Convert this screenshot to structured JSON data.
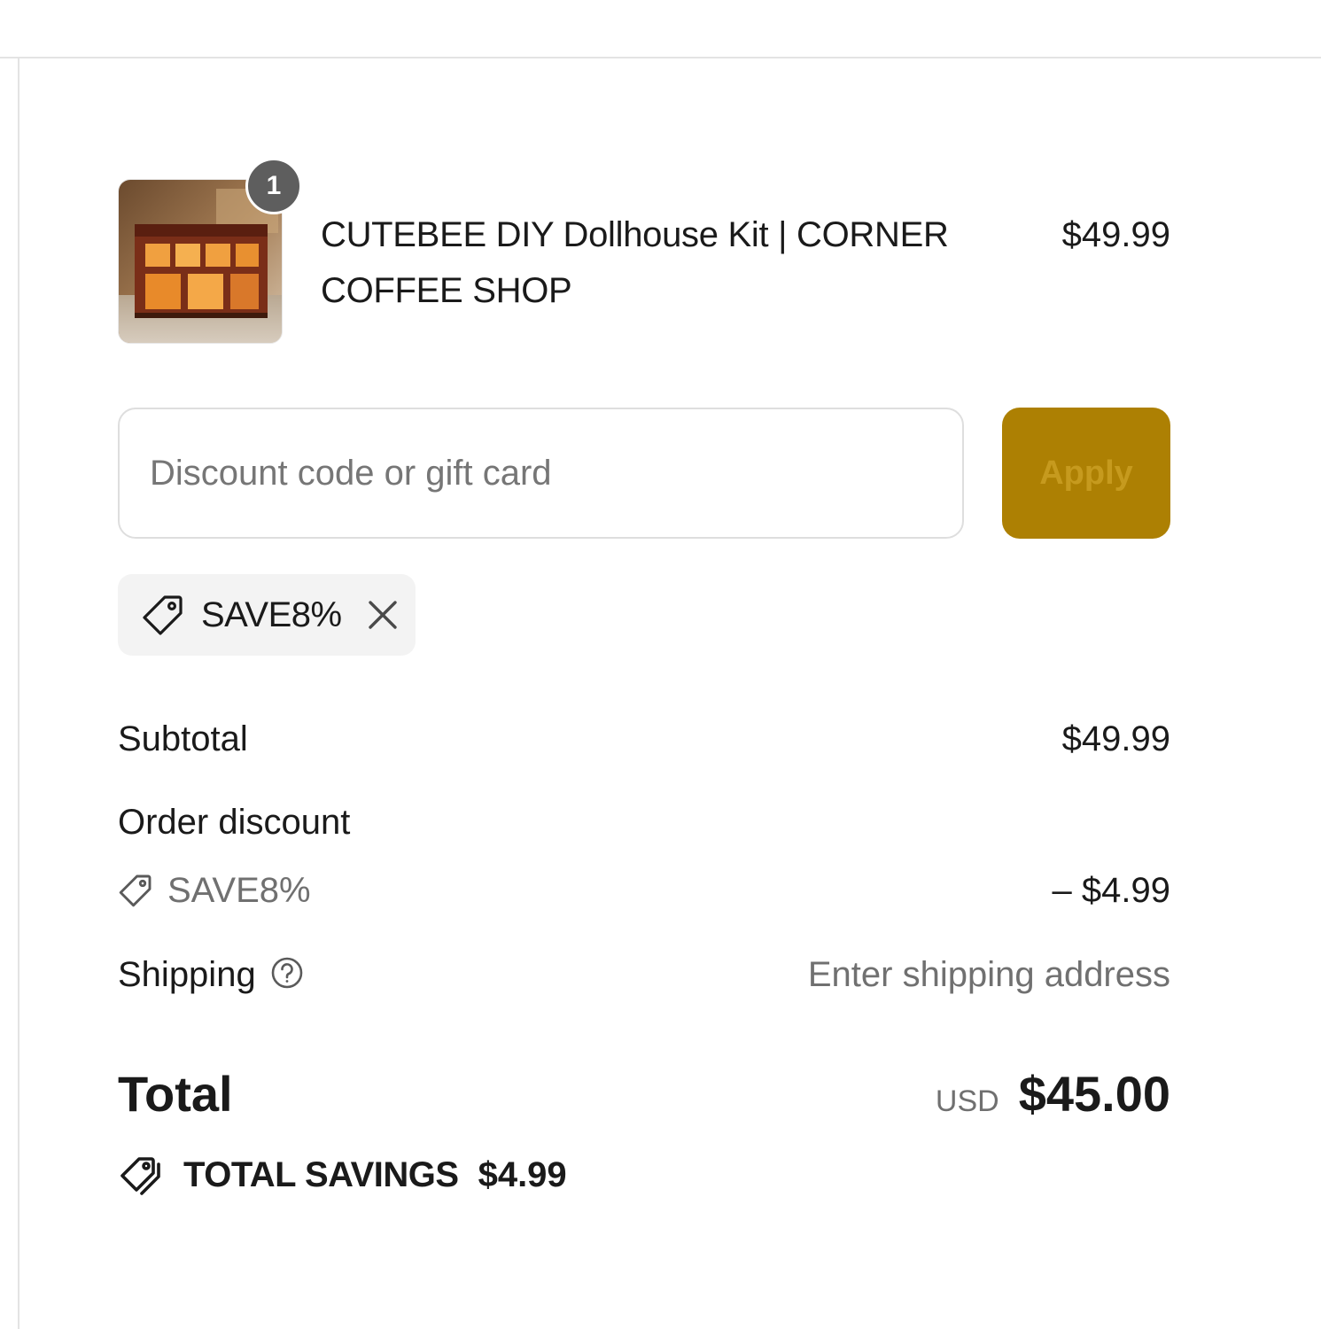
{
  "colors": {
    "accent": "#ad8003",
    "badge": "#5e5e5e",
    "chip_background": "#f3f3f3",
    "muted_text": "#707070"
  },
  "product": {
    "quantity": "1",
    "name": "CUTEBEE DIY Dollhouse Kit | CORNER COFFEE SHOP",
    "price": "$49.99",
    "image_icon": "dollhouse-coffee-shop-image"
  },
  "discount": {
    "placeholder": "Discount code or gift card",
    "value": "",
    "apply_label": "Apply",
    "applied_code": "SAVE8%",
    "tag_icon": "tag-icon",
    "remove_icon": "close-icon"
  },
  "summary": {
    "subtotal_label": "Subtotal",
    "subtotal_value": "$49.99",
    "order_discount_label": "Order discount",
    "order_discount_code": "SAVE8%",
    "order_discount_value": "– $4.99",
    "shipping_label": "Shipping",
    "shipping_help_icon": "question-circle-icon",
    "shipping_value": "Enter shipping address",
    "total_label": "Total",
    "currency": "USD",
    "total_value": "$45.00",
    "savings_icon": "double-tag-icon",
    "savings_label": "TOTAL SAVINGS",
    "savings_value": "$4.99"
  }
}
